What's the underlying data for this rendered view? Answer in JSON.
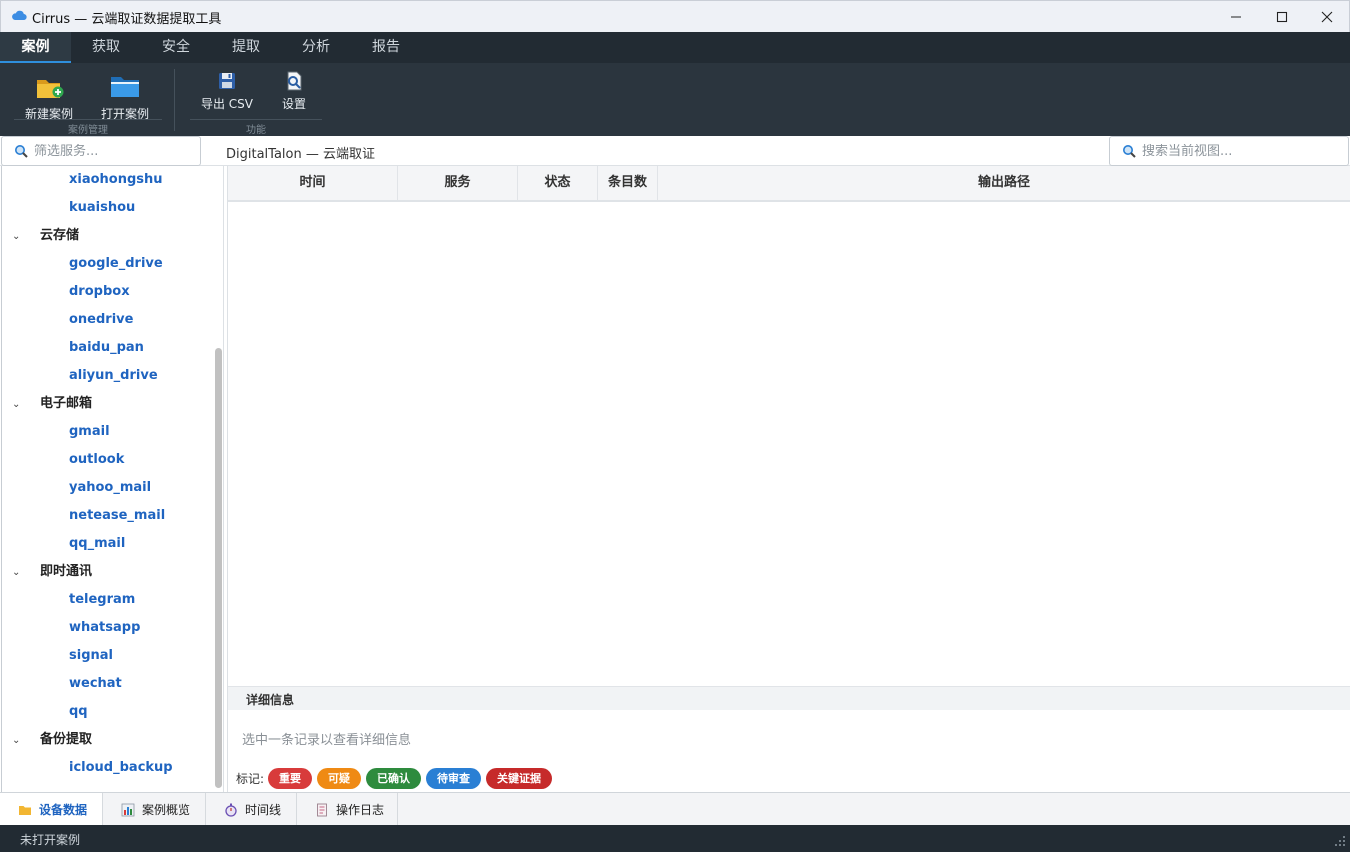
{
  "window": {
    "title": "Cirrus — 云端取证数据提取工具"
  },
  "ribbon_tabs": [
    "案例",
    "获取",
    "安全",
    "提取",
    "分析",
    "报告"
  ],
  "ribbon": {
    "group_case": {
      "label": "案例管理",
      "new_case": "新建案例",
      "open_case": "打开案例"
    },
    "group_func": {
      "label": "功能",
      "export_csv": "导出 CSV",
      "settings": "设置"
    }
  },
  "filter": {
    "placeholder": "筛选服务..."
  },
  "breadcrumb": "DigitalTalon — 云端取证",
  "view_search": {
    "placeholder": "搜索当前视图..."
  },
  "tree": {
    "top_leaves": [
      "xiaohongshu",
      "kuaishou"
    ],
    "categories": [
      {
        "name": "云存储",
        "items": [
          "google_drive",
          "dropbox",
          "onedrive",
          "baidu_pan",
          "aliyun_drive"
        ]
      },
      {
        "name": "电子邮箱",
        "items": [
          "gmail",
          "outlook",
          "yahoo_mail",
          "netease_mail",
          "qq_mail"
        ]
      },
      {
        "name": "即时通讯",
        "items": [
          "telegram",
          "whatsapp",
          "signal",
          "wechat",
          "qq"
        ]
      },
      {
        "name": "备份提取",
        "items": [
          "icloud_backup"
        ]
      }
    ]
  },
  "table": {
    "columns": [
      "时间",
      "服务",
      "状态",
      "条目数",
      "输出路径"
    ]
  },
  "detail": {
    "title": "详细信息",
    "hint": "选中一条记录以查看详细信息",
    "tags_label": "标记:",
    "tags": [
      {
        "label": "重要",
        "color": "#d83b3b"
      },
      {
        "label": "可疑",
        "color": "#ef8a14"
      },
      {
        "label": "已确认",
        "color": "#2e8b3e"
      },
      {
        "label": "待审查",
        "color": "#2a7fd4"
      },
      {
        "label": "关键证据",
        "color": "#c62a2a"
      }
    ]
  },
  "bottom_tabs": [
    {
      "label": "设备数据",
      "icon": "folder-icon"
    },
    {
      "label": "案例概览",
      "icon": "chart-icon"
    },
    {
      "label": "时间线",
      "icon": "stopwatch-icon"
    },
    {
      "label": "操作日志",
      "icon": "log-icon"
    }
  ],
  "status": {
    "text": "未打开案例"
  },
  "colors": {
    "accent": "#2f8fdd",
    "link": "#1f64c0",
    "ribbon": "#2b353e"
  }
}
